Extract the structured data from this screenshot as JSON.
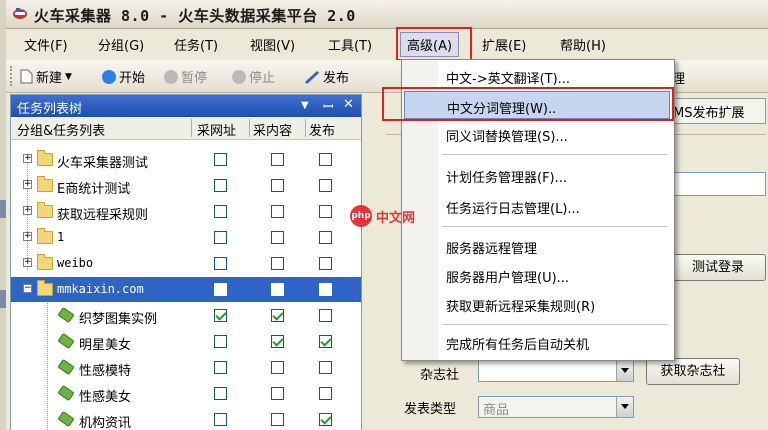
{
  "window": {
    "title": "火车采集器 8.0 - 火车头数据采集平台 2.0"
  },
  "menubar": {
    "items": [
      {
        "label": "文件(F)"
      },
      {
        "label": "分组(G)"
      },
      {
        "label": "任务(T)"
      },
      {
        "label": "视图(V)"
      },
      {
        "label": "工具(T)"
      },
      {
        "label": "高级(A)"
      },
      {
        "label": "扩展(E)"
      },
      {
        "label": "帮助(H)"
      }
    ]
  },
  "toolbar": {
    "new_label": "新建",
    "start_label": "开始",
    "pause_label": "暂停",
    "stop_label": "停止",
    "publish_label": "发布"
  },
  "task_panel": {
    "title": "任务列表树",
    "columns": [
      "分组&任务列表",
      "采网址",
      "采内容",
      "发布"
    ],
    "rows": [
      {
        "label": "火车采集器测试",
        "type": "group"
      },
      {
        "label": "E商统计测试",
        "type": "group"
      },
      {
        "label": "获取远程采规则",
        "type": "group"
      },
      {
        "label": "1",
        "type": "group"
      },
      {
        "label": "weibo",
        "type": "group"
      },
      {
        "label": "mmkaixin.com",
        "type": "group",
        "selected": true
      },
      {
        "label": "织梦图集实例",
        "type": "task",
        "checks": [
          true,
          true,
          false
        ]
      },
      {
        "label": "明星美女",
        "type": "task",
        "checks": [
          false,
          true,
          true
        ]
      },
      {
        "label": "性感模特",
        "type": "task",
        "checks": [
          false,
          false,
          false
        ]
      },
      {
        "label": "性感美女",
        "type": "task",
        "checks": [
          false,
          false,
          false
        ]
      },
      {
        "label": "机构资讯",
        "type": "task",
        "checks": [
          false,
          false,
          true
        ]
      }
    ]
  },
  "dropdown": {
    "items": [
      {
        "label": "中文->英文翻译(T)..."
      },
      {
        "label": "中文分词管理(W)..",
        "highlighted": true
      },
      {
        "label": "同义词替换管理(S)..."
      },
      {
        "label": "计划任务管理器(F)..."
      },
      {
        "label": "任务运行日志管理(L)..."
      },
      {
        "label": "服务器远程管理"
      },
      {
        "label": "服务器用户管理(U)..."
      },
      {
        "label": "获取更新远程采集规则(R)"
      },
      {
        "label": "完成所有任务后自动关机"
      }
    ]
  },
  "right_panel": {
    "tab_label": "MS发布扩展",
    "tab_suffix": "理",
    "test_login_label": "测试登录",
    "magazine_label": "杂志社",
    "get_magazine_label": "获取杂志社",
    "publish_type_label": "发表类型",
    "publish_type_value": "商品"
  },
  "watermark": {
    "logo": "php",
    "text": "中文网"
  },
  "colors": {
    "highlight_red": "#e0201c",
    "panel_blue": "#2f63c5",
    "check_green": "#21a121"
  }
}
